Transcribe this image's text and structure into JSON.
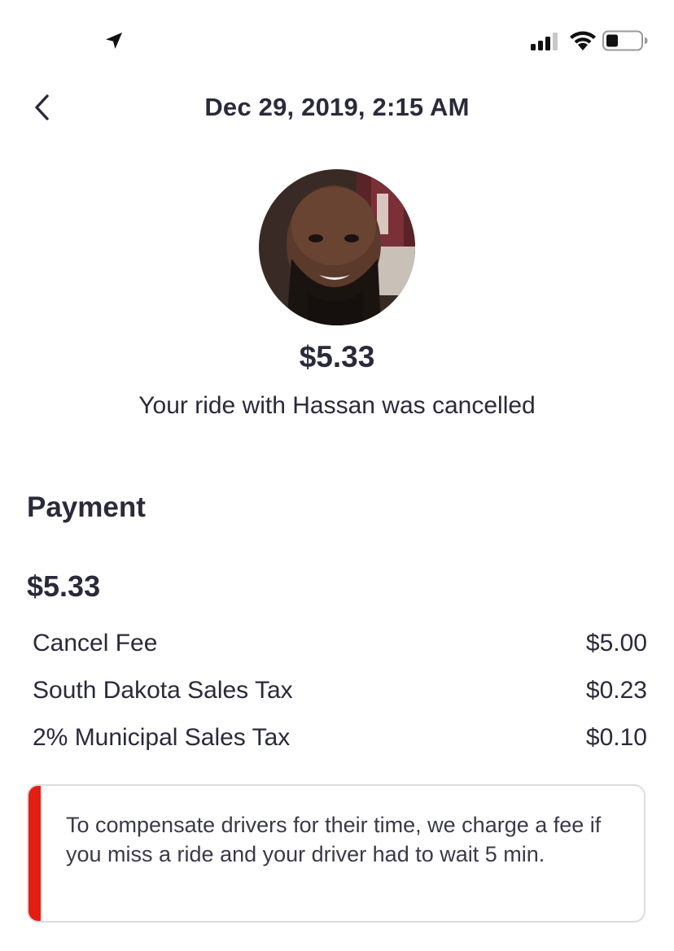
{
  "status_bar": {
    "icons": [
      "location-arrow-icon",
      "cellular-signal-icon",
      "wifi-icon",
      "battery-icon"
    ]
  },
  "header": {
    "back_icon": "chevron-left-icon",
    "title": "Dec 29, 2019, 2:15 AM"
  },
  "ride": {
    "avatar": "driver-photo",
    "amount": "$5.33",
    "status_text": "Your ride with Hassan was cancelled"
  },
  "payment": {
    "section_title": "Payment",
    "total": "$5.33",
    "line_items": [
      {
        "label": "Cancel Fee",
        "amount": "$5.00"
      },
      {
        "label": "South Dakota Sales Tax",
        "amount": "$0.23"
      },
      {
        "label": "2% Municipal Sales Tax",
        "amount": "$0.10"
      }
    ]
  },
  "notice": {
    "text": "To compensate drivers for their time, we charge a fee if you miss a ride and your driver had to wait 5 min.",
    "accent_color": "#e41e12"
  }
}
